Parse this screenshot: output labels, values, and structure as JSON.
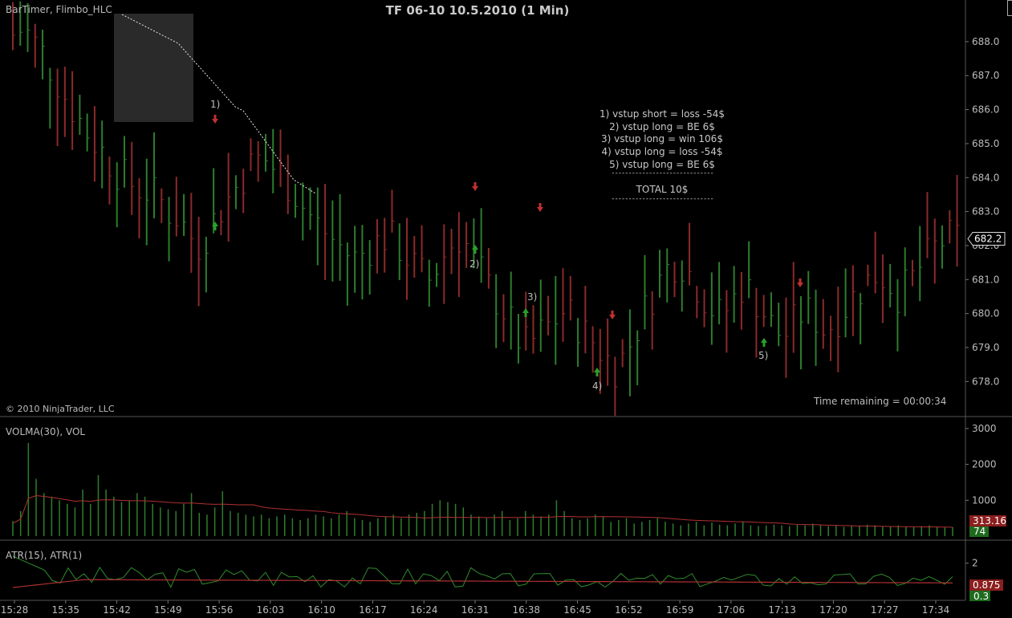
{
  "chart_data": {
    "type": "ohlc",
    "title": "TF 06-10 10.5.2010 (1 Min)",
    "indicator_label": "BarTimer, Flimbo_HLC",
    "copyright": "© 2010 NinjaTrader, LLC",
    "time_remaining": "Time remaining = 00:00:34",
    "price_axis": {
      "ticks": [
        "688.0",
        "687.0",
        "686.0",
        "685.0",
        "684.0",
        "683.0",
        "682.0",
        "681.0",
        "680.0",
        "679.0",
        "678.0"
      ],
      "ylim": [
        677.3,
        688.8
      ]
    },
    "last_price": "682.2",
    "time_axis": [
      "15:28",
      "15:35",
      "15:42",
      "15:49",
      "15:56",
      "16:03",
      "16:10",
      "16:17",
      "16:24",
      "16:31",
      "16:38",
      "16:45",
      "16:52",
      "16:59",
      "17:06",
      "17:13",
      "17:20",
      "17:27",
      "17:34"
    ],
    "trade_labels": [
      "1)",
      "2)",
      "3)",
      "4)",
      "5)"
    ],
    "legend": [
      "1) vstup short = loss -54$",
      "2) vstup long = BE 6$",
      "3) vstup long = win 106$",
      "4) vstup long = loss -54$",
      "5) vstup long = BE 6$"
    ],
    "legend_separator": "------------------------------",
    "total": "TOTAL 10$",
    "close_path": [
      688.2,
      688.4,
      688.0,
      687.6,
      687.0,
      686.4,
      685.9,
      685.4,
      685.0,
      684.6,
      684.2,
      683.9,
      683.7,
      683.6,
      683.4,
      683.0,
      682.8,
      682.3,
      682.0,
      682.6,
      683.1,
      683.5,
      684.0,
      684.4,
      684.6,
      684.3,
      684.0,
      683.6,
      683.1,
      682.7,
      682.4,
      682.1,
      681.8,
      681.6,
      681.9,
      682.1,
      682.3,
      682.0,
      681.6,
      681.2,
      681.0,
      681.5,
      682.0,
      682.3,
      681.8,
      681.2,
      680.6,
      680.2,
      679.6,
      679.0,
      679.2,
      679.5,
      679.8,
      680.1,
      679.8,
      679.4,
      679.1,
      678.7,
      678.4,
      678.9,
      679.6,
      680.3,
      680.9,
      681.4,
      681.6,
      681.2,
      680.7,
      680.2,
      679.9,
      680.3,
      680.8,
      680.6,
      680.1,
      679.6,
      679.3,
      679.7,
      680.1,
      679.9,
      679.5,
      679.8,
      680.2,
      680.6,
      680.9,
      681.2,
      681.0,
      680.6,
      680.8,
      681.3,
      681.7,
      682.1,
      682.2
    ],
    "volume_panel": {
      "label": "VOLMA(30), VOL",
      "ticks": [
        "3000",
        "2000",
        "1000"
      ],
      "ylim": [
        0,
        3200
      ],
      "volma_value": "313.16",
      "vol_value": "74",
      "volume_profile": [
        420,
        700,
        2600,
        1600,
        1200,
        1100,
        1000,
        900,
        800,
        1300,
        900,
        1700,
        1300,
        1100,
        950,
        1000,
        1200,
        1100,
        900,
        800,
        750,
        700,
        900,
        1200,
        650,
        600,
        800,
        1250,
        700,
        650,
        600,
        550,
        600,
        500,
        550,
        600,
        500,
        450,
        500,
        600,
        550,
        500,
        600,
        700,
        500,
        450,
        400,
        500,
        550,
        600,
        500,
        600,
        650,
        700,
        900,
        1000,
        950,
        900,
        800,
        600,
        550,
        500,
        600,
        700,
        450,
        500,
        700,
        600,
        550,
        600,
        1000,
        700,
        500,
        450,
        500,
        600,
        550,
        400,
        450,
        500,
        350,
        400,
        450,
        500,
        400,
        350,
        300,
        350,
        400,
        300,
        380,
        320,
        300,
        350,
        400,
        300,
        280,
        300,
        320,
        300,
        280,
        320,
        300,
        350,
        300,
        280,
        300,
        260,
        300,
        280,
        320,
        300,
        260,
        280,
        300,
        260,
        250,
        280,
        300,
        260,
        240,
        250
      ]
    },
    "atr_panel": {
      "label": "ATR(15), ATR(1)",
      "ticks": [
        "2"
      ],
      "ylim": [
        0,
        3
      ],
      "atr15_value": "0.875",
      "atr1_value": "0.3"
    }
  }
}
